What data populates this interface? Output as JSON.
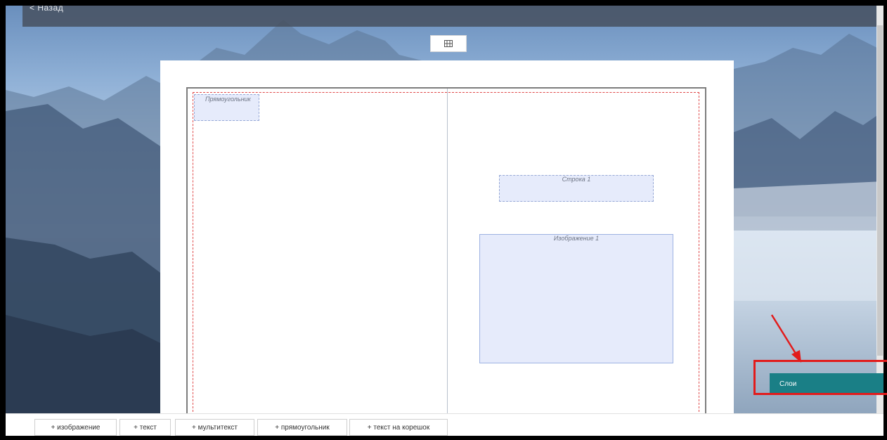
{
  "header": {
    "back_label": "< Назад"
  },
  "canvas": {
    "layers": {
      "rectangle_label": "Прямоугольник",
      "line_label": "Строка 1",
      "image_label": "Изображение 1"
    }
  },
  "sidebar": {
    "layers_button_label": "Слои"
  },
  "toolbar": {
    "buttons": [
      {
        "label": "+ изображение"
      },
      {
        "label": "+ текст"
      },
      {
        "label": "+ мультитекст"
      },
      {
        "label": "+ прямоугольник"
      },
      {
        "label": "+ текст на корешок"
      }
    ]
  },
  "colors": {
    "accent": "#1a7f86",
    "highlight": "#e21b1b",
    "layer_fill": "#e6ebfb"
  },
  "icons": {
    "toggle": "grid-icon"
  }
}
